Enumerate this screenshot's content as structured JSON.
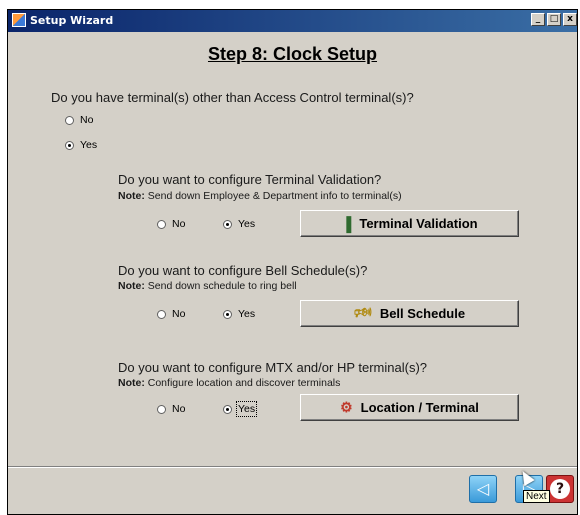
{
  "window": {
    "title": "Setup Wizard",
    "controls": [
      "_",
      "□",
      "x"
    ]
  },
  "step_title": "Step 8: Clock Setup",
  "main_question": {
    "text": "Do you have terminal(s) other than Access Control terminal(s)?",
    "options": [
      {
        "label": "No",
        "selected": false
      },
      {
        "label": "Yes",
        "selected": true
      }
    ]
  },
  "sections": [
    {
      "question": "Do you want to configure Terminal Validation?",
      "note_prefix": "Note:",
      "note": " Send down Employee & Department info to terminal(s)",
      "no_label": "No",
      "yes_label": "Yes",
      "selected": "Yes",
      "button_label": "Terminal Validation",
      "button_icon": "▐"
    },
    {
      "question": "Do you want to configure Bell Schedule(s)?",
      "note_prefix": "Note:",
      "note": " Send down schedule to ring bell",
      "no_label": "No",
      "yes_label": "Yes",
      "selected": "Yes",
      "button_label": "Bell Schedule",
      "button_icon": "🕬"
    },
    {
      "question": "Do you want to configure MTX and/or HP terminal(s)?",
      "note_prefix": "Note:",
      "note": " Configure location and discover terminals",
      "no_label": "No",
      "yes_label": "Yes",
      "selected": "Yes",
      "button_label": "Location / Terminal",
      "button_icon": "⚙"
    }
  ],
  "footer": {
    "back_icon": "◁",
    "next_icon": "▷",
    "help_icon": "?",
    "tooltip": "Next"
  }
}
